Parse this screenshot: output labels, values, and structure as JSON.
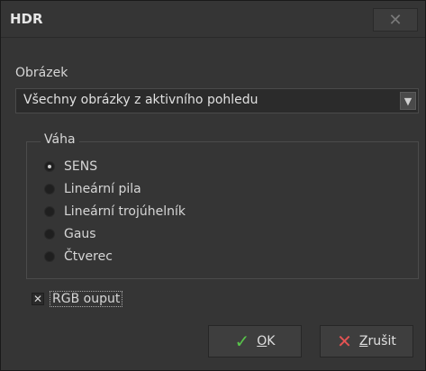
{
  "window": {
    "title": "HDR",
    "close_glyph": "✕"
  },
  "image_section": {
    "label": "Obrázek",
    "selected_value": "Všechny obrázky z aktivního pohledu",
    "dropdown_arrow_glyph": "▼"
  },
  "weight_group": {
    "title": "Váha",
    "options": [
      {
        "label": "SENS",
        "selected": true
      },
      {
        "label": "Lineární pila",
        "selected": false
      },
      {
        "label": "Lineární trojúhelník",
        "selected": false
      },
      {
        "label": "Gaus",
        "selected": false
      },
      {
        "label": "Čtverec",
        "selected": false
      }
    ]
  },
  "rgb_checkbox": {
    "label": "RGB ouput",
    "checked_glyph": "✕",
    "checked": true
  },
  "buttons": {
    "ok_label": "OK",
    "ok_icon": "check-icon",
    "ok_glyph": "✓",
    "cancel_label": "Zrušit",
    "cancel_icon": "x-icon",
    "cancel_glyph": "✕"
  },
  "colors": {
    "background": "#353535",
    "ok_check": "#58c44a",
    "cancel_x": "#e35353"
  }
}
